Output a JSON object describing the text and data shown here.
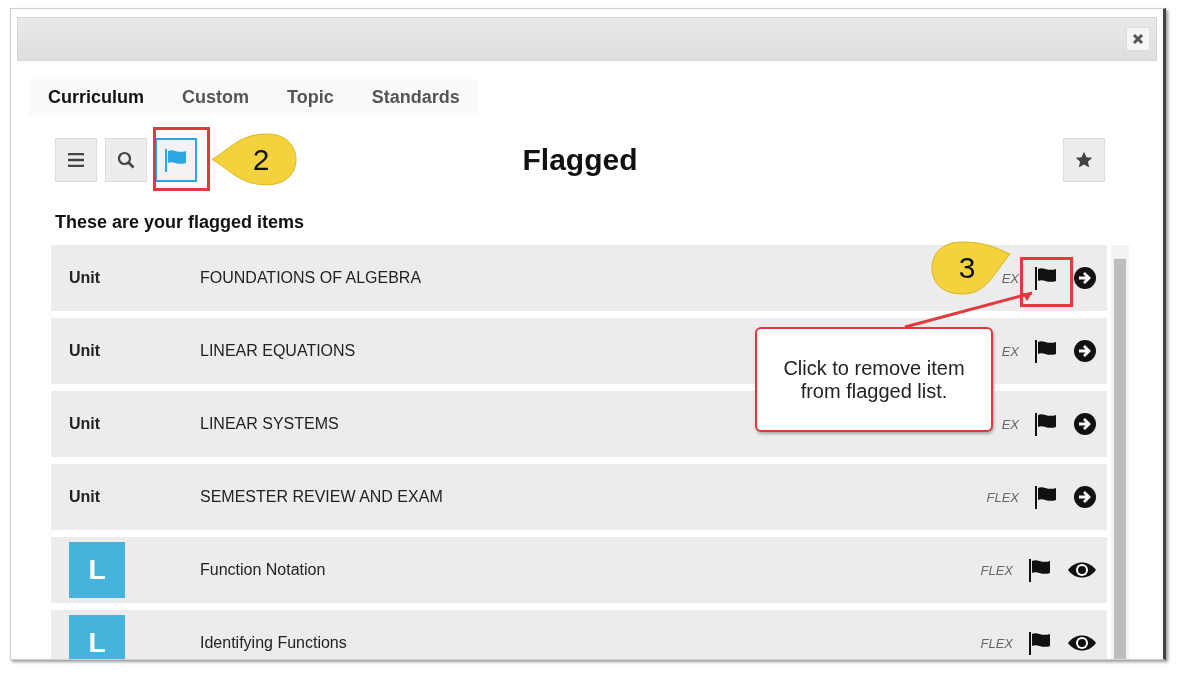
{
  "tabs": [
    {
      "label": "Curriculum",
      "selected": true
    },
    {
      "label": "Custom",
      "selected": false
    },
    {
      "label": "Topic",
      "selected": false
    },
    {
      "label": "Standards",
      "selected": false
    }
  ],
  "toolbar": {
    "buttons": [
      {
        "kind": "menu",
        "selected": false
      },
      {
        "kind": "search",
        "selected": false
      },
      {
        "kind": "flag",
        "selected": true
      }
    ],
    "title": "Flagged"
  },
  "subtitle": "These are your flagged items",
  "items": [
    {
      "kind": "unit",
      "type_label": "Unit",
      "title": "FOUNDATIONS OF ALGEBRA",
      "tag": "EX",
      "flagged": true
    },
    {
      "kind": "unit",
      "type_label": "Unit",
      "title": "LINEAR EQUATIONS",
      "tag": "EX",
      "flagged": true
    },
    {
      "kind": "unit",
      "type_label": "Unit",
      "title": "LINEAR SYSTEMS",
      "tag": "EX",
      "flagged": true
    },
    {
      "kind": "unit",
      "type_label": "Unit",
      "title": "SEMESTER REVIEW AND EXAM",
      "tag": "FLEX",
      "flagged": true
    },
    {
      "kind": "lesson",
      "type_label": "L",
      "title": "Function Notation",
      "tag": "FLEX",
      "flagged": true
    },
    {
      "kind": "lesson",
      "type_label": "L",
      "title": "Identifying Functions",
      "tag": "FLEX",
      "flagged": true
    }
  ],
  "annotations": [
    {
      "number": "2",
      "kind": "pointing-left"
    },
    {
      "number": "3",
      "kind": "pointing-right"
    }
  ],
  "callout": {
    "text": "Click to remove item from flagged list."
  }
}
